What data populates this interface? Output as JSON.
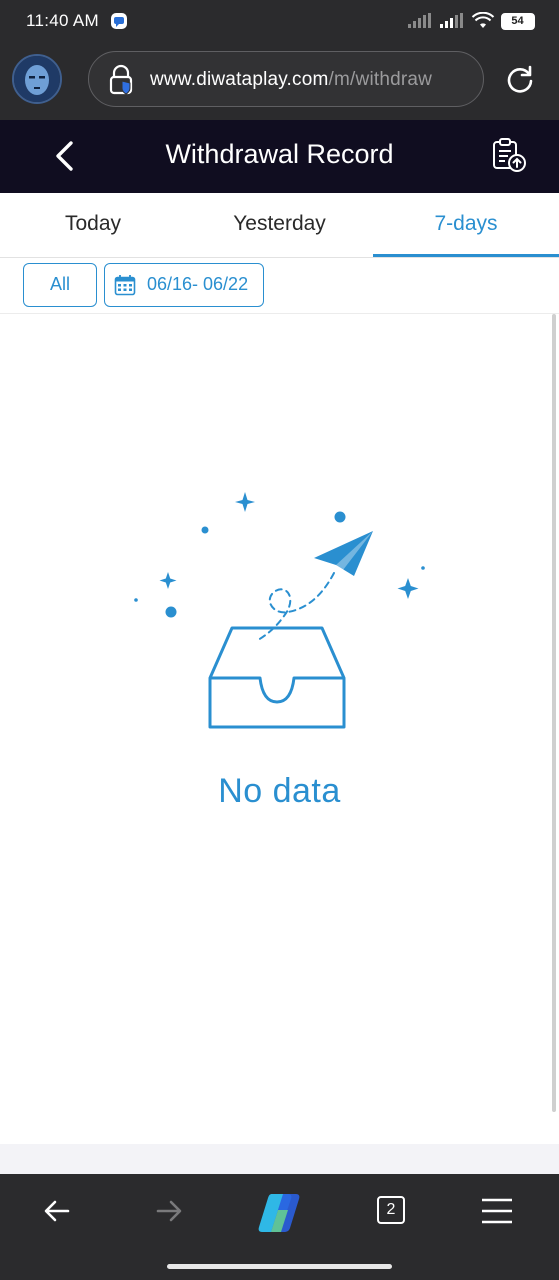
{
  "status_bar": {
    "time": "11:40 AM",
    "battery": "54",
    "icons": [
      "notification-icon",
      "signal-icon",
      "signal-icon",
      "wifi-icon",
      "battery-icon"
    ]
  },
  "browser": {
    "url_host": "www.diwataplay.com",
    "url_path": "/m/withdraw",
    "icons": [
      "avatar",
      "lock-icon",
      "reload-icon"
    ]
  },
  "header": {
    "title": "Withdrawal Record",
    "icons": [
      "chevron-left-icon",
      "clipboard-upload-icon"
    ]
  },
  "tabs": [
    {
      "label": "Today",
      "active": false
    },
    {
      "label": "Yesterday",
      "active": false
    },
    {
      "label": "7-days",
      "active": true
    }
  ],
  "filters": {
    "status_label": "All",
    "date_range": "06/16- 06/22"
  },
  "empty_state": {
    "message": "No data",
    "icon": "empty-inbox-paper-plane-icon"
  },
  "bottom_nav": {
    "tab_count": "2",
    "icons": [
      "back-arrow-icon",
      "forward-arrow-icon",
      "copilot-icon",
      "tabs-icon",
      "menu-icon"
    ]
  },
  "colors": {
    "accent": "#2a8fd0",
    "header_bg": "#100d20",
    "browser_bg": "#2b2b2d"
  }
}
